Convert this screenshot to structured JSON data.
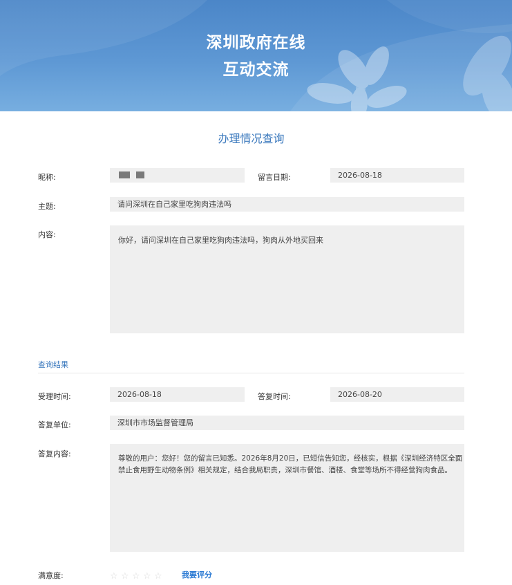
{
  "header": {
    "line1": "深圳政府在线",
    "line2": "互动交流"
  },
  "query": {
    "title": "办理情况查询",
    "nickname_label": "昵称:",
    "nickname_value": "",
    "date_label": "留言日期:",
    "date_value": "2026-08-18",
    "subject_label": "主题:",
    "subject_value": "请问深圳在自己家里吃狗肉违法吗",
    "content_label": "内容:",
    "content_value": "你好，请问深圳在自己家里吃狗肉违法吗，狗肉从外地买回来"
  },
  "result": {
    "title": "查询结果",
    "accept_time_label": "受理时间:",
    "accept_time_value": "2026-08-18",
    "reply_time_label": "答复时间:",
    "reply_time_value": "2026-08-20",
    "reply_unit_label": "答复单位:",
    "reply_unit_value": "深圳市市场监督管理局",
    "reply_content_label": "答复内容:",
    "reply_content_line1": "尊敬的用户：您好！您的留言已知悉。2026年8月20日，已短信告知您，经核实，根据《深圳经济特区全面",
    "reply_content_line2": "禁止食用野生动物条例》相关规定，结合我局职责，深圳市餐馆、酒楼、食堂等场所不得经营狗肉食品。"
  },
  "rating": {
    "label": "满意度:",
    "stars": [
      "☆",
      "☆",
      "☆",
      "☆",
      "☆"
    ],
    "rating_value": 0,
    "rate_link": "我要评分"
  },
  "colors": {
    "accent": "#3a78bd",
    "link": "#2b7ad3",
    "banner": "#5e98d4",
    "field_bg": "#efefef"
  }
}
